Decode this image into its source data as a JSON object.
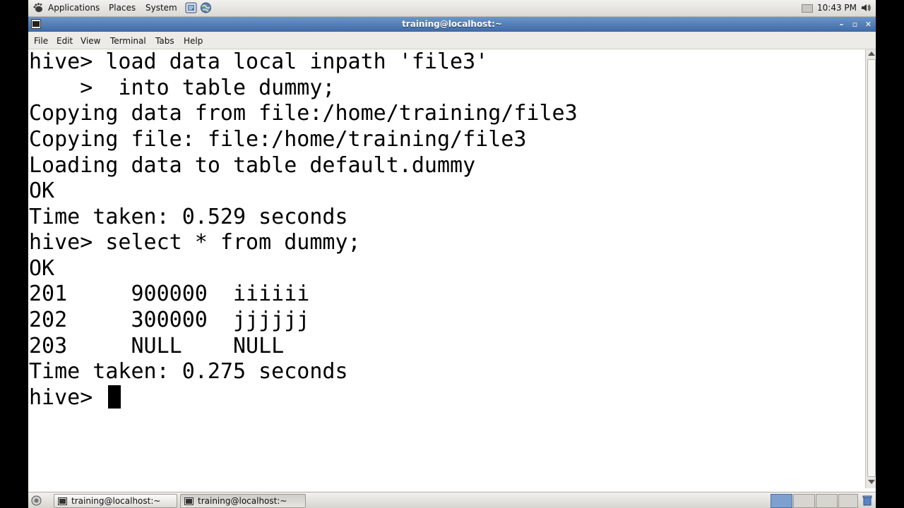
{
  "top_panel": {
    "menus": [
      "Applications",
      "Places",
      "System"
    ],
    "clock": "10:43 PM"
  },
  "window": {
    "title": "training@localhost:~",
    "menu": [
      "File",
      "Edit",
      "View",
      "Terminal",
      "Tabs",
      "Help"
    ]
  },
  "terminal": {
    "lines": [
      "hive> load data local inpath 'file3'",
      "    >  into table dummy;",
      "Copying data from file:/home/training/file3",
      "Copying file: file:/home/training/file3",
      "Loading data to table default.dummy",
      "OK",
      "Time taken: 0.529 seconds",
      "hive> select * from dummy;",
      "OK",
      "201     900000  iiiiii",
      "202     300000  jjjjjj",
      "203     NULL    NULL",
      "Time taken: 0.275 seconds",
      "hive> "
    ]
  },
  "taskbar": {
    "tasks": [
      {
        "label": "training@localhost:~"
      },
      {
        "label": "training@localhost:~"
      }
    ]
  },
  "colors": {
    "title_bar": "#4a76b0",
    "terminal_bg": "#ffffff",
    "terminal_fg": "#000000"
  }
}
